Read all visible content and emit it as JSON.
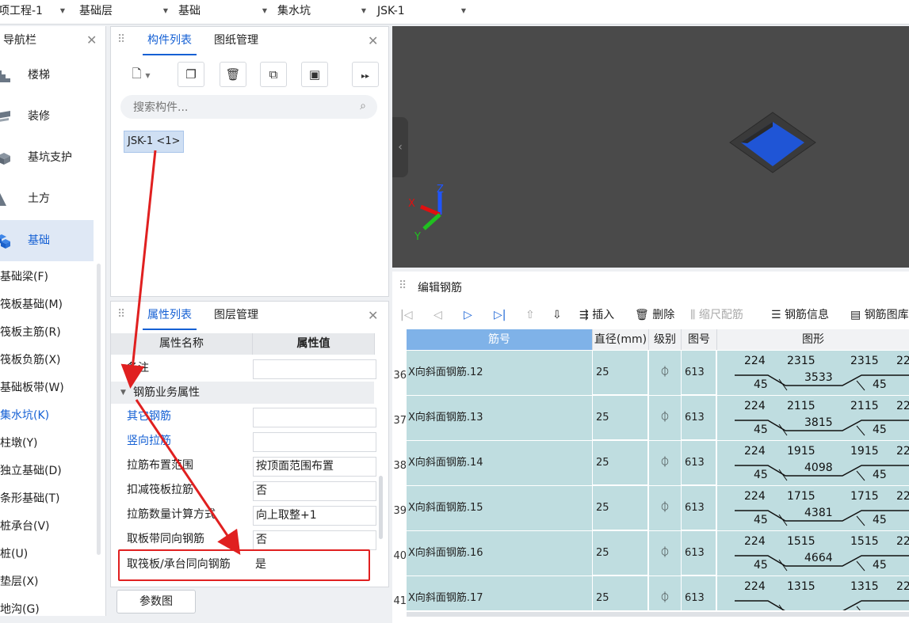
{
  "topbar": {
    "dropdowns": [
      "项工程-1",
      "基础层",
      "基础",
      "集水坑",
      "JSK-1"
    ]
  },
  "nav": {
    "title": "导航栏",
    "categories": [
      "楼梯",
      "装修",
      "基坑支护",
      "土方",
      "基础"
    ],
    "items": [
      "基础梁(F)",
      "筏板基础(M)",
      "筏板主筋(R)",
      "筏板负筋(X)",
      "基础板带(W)",
      "集水坑(K)",
      "柱墩(Y)",
      "独立基础(D)",
      "条形基础(T)",
      "桩承台(V)",
      "桩(U)",
      "垫层(X)",
      "地沟(G)"
    ],
    "selected_category": "基础",
    "selected_item": "集水坑(K)"
  },
  "component_panel": {
    "tabs": [
      "构件列表",
      "图纸管理"
    ],
    "search_placeholder": "搜索构件...",
    "components": [
      "JSK-1 <1>"
    ]
  },
  "property_panel": {
    "tabs": [
      "属性列表",
      "图层管理"
    ],
    "headers": [
      "属性名称",
      "属性值"
    ],
    "rows": [
      {
        "name": "备注",
        "value": ""
      },
      {
        "group": "钢筋业务属性"
      },
      {
        "name": "其它钢筋",
        "value": "",
        "link": true
      },
      {
        "name": "竖向拉筋",
        "value": "",
        "link": true
      },
      {
        "name": "拉筋布置范围",
        "value": "按顶面范围布置"
      },
      {
        "name": "扣减筏板拉筋",
        "value": "否"
      },
      {
        "name": "拉筋数量计算方式",
        "value": "向上取整+1"
      },
      {
        "name": "取板带同向钢筋",
        "value": "否"
      },
      {
        "name": "取筏板/承台同向钢筋",
        "value": "是"
      }
    ],
    "param_button": "参数图"
  },
  "rebar_editor": {
    "title": "编辑钢筋",
    "toolbar": [
      "插入",
      "删除",
      "缩尺配筋",
      "钢筋信息",
      "钢筋图库"
    ],
    "columns": [
      "筋号",
      "直径(mm)",
      "级别",
      "图号",
      "图形"
    ],
    "rows": [
      {
        "num": "36",
        "name": "X向斜面钢筋.12",
        "dia": "25",
        "grade": "⏀",
        "fig": "613",
        "s": [
          "224",
          "2315",
          "2315",
          "22",
          "45",
          "3533",
          "45"
        ]
      },
      {
        "num": "37",
        "name": "X向斜面钢筋.13",
        "dia": "25",
        "grade": "⏀",
        "fig": "613",
        "s": [
          "224",
          "2115",
          "2115",
          "22",
          "45",
          "3815",
          "45"
        ]
      },
      {
        "num": "38",
        "name": "X向斜面钢筋.14",
        "dia": "25",
        "grade": "⏀",
        "fig": "613",
        "s": [
          "224",
          "1915",
          "1915",
          "22",
          "45",
          "4098",
          "45"
        ]
      },
      {
        "num": "39",
        "name": "X向斜面钢筋.15",
        "dia": "25",
        "grade": "⏀",
        "fig": "613",
        "s": [
          "224",
          "1715",
          "1715",
          "22",
          "45",
          "4381",
          "45"
        ]
      },
      {
        "num": "40",
        "name": "X向斜面钢筋.16",
        "dia": "25",
        "grade": "⏀",
        "fig": "613",
        "s": [
          "224",
          "1515",
          "1515",
          "22",
          "45",
          "4664",
          "45"
        ]
      },
      {
        "num": "41",
        "name": "X向斜面钢筋.17",
        "dia": "25",
        "grade": "⏀",
        "fig": "613",
        "s": [
          "224",
          "1315",
          "1315",
          "22",
          "",
          "",
          ""
        ]
      }
    ]
  },
  "colors": {
    "accent": "#1560d4",
    "highlight": "#e02020",
    "grid_row": "#bfdde0",
    "view_bg": "#4a4a4a"
  }
}
